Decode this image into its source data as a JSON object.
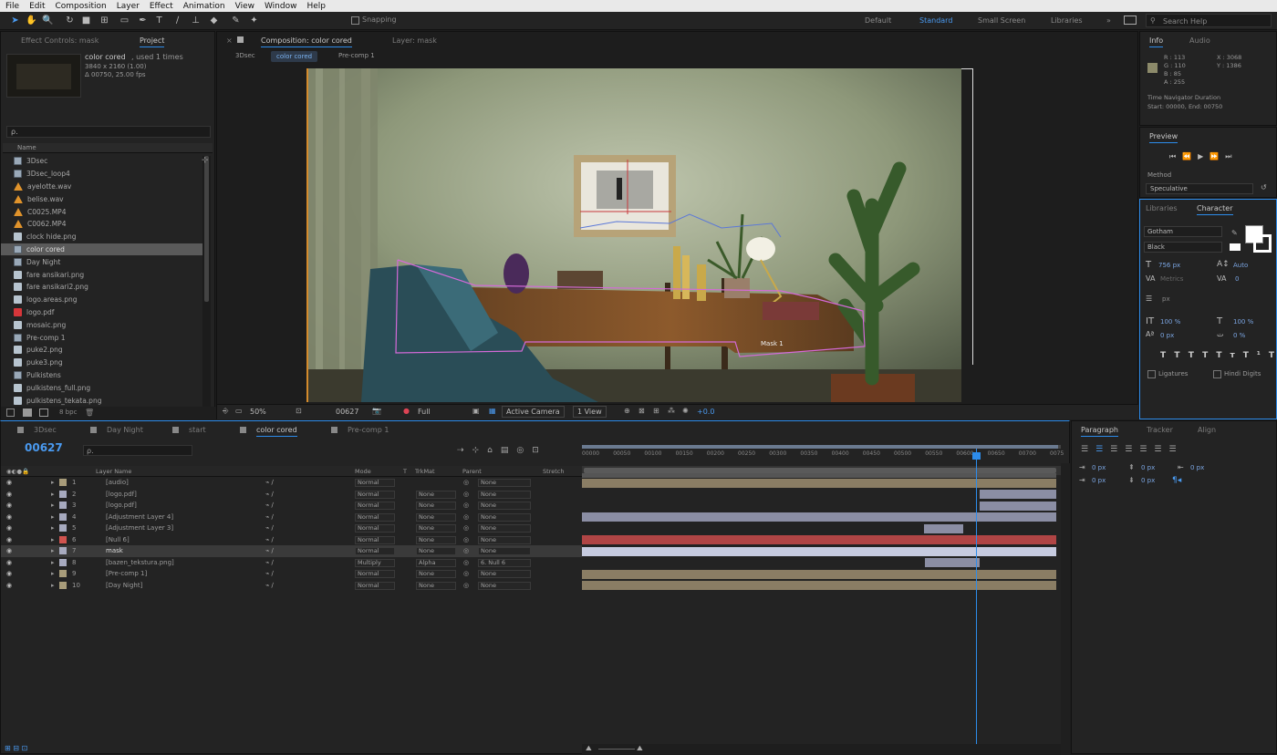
{
  "menu": [
    "File",
    "Edit",
    "Composition",
    "Layer",
    "Effect",
    "Animation",
    "View",
    "Window",
    "Help"
  ],
  "toolbar": {
    "snapping_label": "Snapping",
    "workspaces": [
      "Default",
      "Standard",
      "Small Screen",
      "Libraries"
    ],
    "active_workspace": "Standard",
    "search_placeholder": "Search Help"
  },
  "project_panel": {
    "tabs": [
      "Effect Controls: mask",
      "Project"
    ],
    "selected_name": "color cored",
    "selected_used": ", used 1 times",
    "selected_size": "3840 x 2160 (1.00)",
    "selected_duration": "Δ 00750, 25.00 fps",
    "search_placeholder": "ρ.",
    "column_name": "Name",
    "items": [
      {
        "name": "3Dsec",
        "type": "comp"
      },
      {
        "name": "3Dsec_loop4",
        "type": "comp"
      },
      {
        "name": "ayelotte.wav",
        "type": "audio"
      },
      {
        "name": "belise.wav",
        "type": "audio"
      },
      {
        "name": "C0025.MP4",
        "type": "audio"
      },
      {
        "name": "C0062.MP4",
        "type": "audio"
      },
      {
        "name": "clock hide.png",
        "type": "image"
      },
      {
        "name": "color cored",
        "type": "comp",
        "selected": true
      },
      {
        "name": "Day Night",
        "type": "comp"
      },
      {
        "name": "fare ansikari.png",
        "type": "image"
      },
      {
        "name": "fare ansikari2.png",
        "type": "image"
      },
      {
        "name": "logo.areas.png",
        "type": "image"
      },
      {
        "name": "logo.pdf",
        "type": "pdf"
      },
      {
        "name": "mosaic.png",
        "type": "image"
      },
      {
        "name": "Pre-comp 1",
        "type": "comp"
      },
      {
        "name": "puke2.png",
        "type": "image"
      },
      {
        "name": "puke3.png",
        "type": "image"
      },
      {
        "name": "Pulkistens",
        "type": "comp"
      },
      {
        "name": "pulkistens_full.png",
        "type": "image"
      },
      {
        "name": "pulkistens_tekata.png",
        "type": "image"
      }
    ],
    "bpc": "8 bpc"
  },
  "composition_panel": {
    "tabs": [
      "Composition: color cored",
      "Layer: mask"
    ],
    "subtabs": [
      "3Dsec",
      "color cored",
      "Pre-comp 1"
    ],
    "zoom": "50%",
    "timecode": "00627",
    "resolution": "Full",
    "camera": "Active Camera",
    "views": "1 View",
    "exposure": "+0.0",
    "mask_label": "Mask 1"
  },
  "info_panel": {
    "tabs": [
      "Info",
      "Audio"
    ],
    "r_label": "R : 113",
    "g_label": "G : 110",
    "b_label": "B : 85",
    "a_label": "A : 255",
    "x_label": "X : 3068",
    "y_label": "Y : 1386",
    "time_nav_line1": "Time Navigator Duration",
    "time_nav_line2": "Start: 00000, End: 00750",
    "swatch_color": "#8c8a6a"
  },
  "preview_panel": {
    "title": "Preview",
    "method_label": "Method",
    "method_value": "Speculative"
  },
  "character_panel": {
    "tabs": [
      "Libraries",
      "Character"
    ],
    "font": "Gotham",
    "style": "Black",
    "size": "756 px",
    "leading": "Auto",
    "kerning": "Metrics",
    "tracking": "0",
    "stroke_unit": "px",
    "vscale": "100 %",
    "hscale": "100 %",
    "baseline": "0 px",
    "tsume": "0 %",
    "ligatures": "Ligatures",
    "hindi_digits": "Hindi Digits"
  },
  "timeline": {
    "tabs": [
      "3Dsec",
      "Day Night",
      "start",
      "color cored",
      "Pre-comp 1"
    ],
    "active_tab": "color cored",
    "timecode": "00627",
    "search_placeholder": "ρ.",
    "columns": [
      "Layer Name",
      "Mode",
      "T",
      "TrkMat",
      "Parent",
      "Stretch"
    ],
    "ruler": [
      "00000",
      "00050",
      "00100",
      "00150",
      "00200",
      "00250",
      "00300",
      "00350",
      "00400",
      "00450",
      "00500",
      "00550",
      "00600",
      "00650",
      "00700",
      "0075"
    ],
    "layers": [
      {
        "num": "1",
        "name": "[audio]",
        "mode": "Normal",
        "trkmat": "",
        "parent": "None",
        "label": "#a89c7a"
      },
      {
        "num": "2",
        "name": "[logo.pdf]",
        "mode": "Normal",
        "trkmat": "None",
        "parent": "None",
        "label": "#a7aabf"
      },
      {
        "num": "3",
        "name": "[logo.pdf]",
        "mode": "Normal",
        "trkmat": "None",
        "parent": "None",
        "label": "#a7aabf"
      },
      {
        "num": "4",
        "name": "[Adjustment Layer 4]",
        "mode": "Normal",
        "trkmat": "None",
        "parent": "None",
        "label": "#a7aabf"
      },
      {
        "num": "5",
        "name": "[Adjustment Layer 3]",
        "mode": "Normal",
        "trkmat": "None",
        "parent": "None",
        "label": "#a7aabf"
      },
      {
        "num": "6",
        "name": "[Null 6]",
        "mode": "Normal",
        "trkmat": "None",
        "parent": "None",
        "label": "#d0534f"
      },
      {
        "num": "7",
        "name": "mask",
        "mode": "Normal",
        "trkmat": "None",
        "parent": "None",
        "label": "#a7aabf",
        "selected": true
      },
      {
        "num": "8",
        "name": "[bazen_tekstura.png]",
        "mode": "Multiply",
        "trkmat": "Alpha",
        "parent": "6. Null 6",
        "label": "#a7aabf"
      },
      {
        "num": "9",
        "name": "[Pre-comp 1]",
        "mode": "Normal",
        "trkmat": "None",
        "parent": "None",
        "label": "#a89c7a"
      },
      {
        "num": "10",
        "name": "[Day Night]",
        "mode": "Normal",
        "trkmat": "None",
        "parent": "None",
        "label": "#a89c7a"
      }
    ]
  },
  "right_bottom": {
    "tabs": [
      "Paragraph",
      "Tracker",
      "Align"
    ],
    "indent_left": "0 px",
    "indent_right": "0 px",
    "space_before": "0 px",
    "space_after": "0 px",
    "first_line": "0 px"
  }
}
